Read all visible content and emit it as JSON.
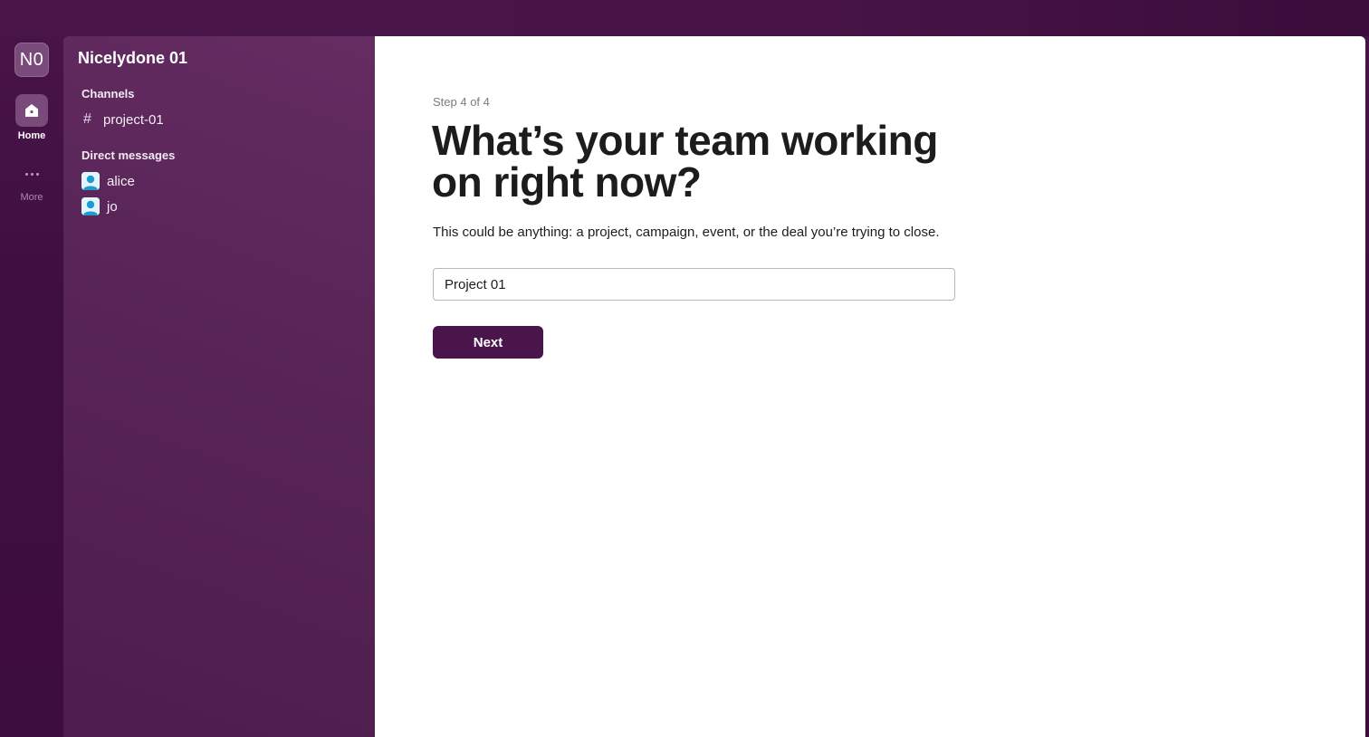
{
  "workspace": {
    "initials": "N0",
    "name": "Nicelydone 01"
  },
  "rail": {
    "home_label": "Home",
    "more_label": "More",
    "home_icon": "home-icon",
    "more_icon": "ellipsis-icon"
  },
  "sidebar": {
    "channels_title": "Channels",
    "channels": [
      {
        "label": "project-01",
        "icon": "hash-icon"
      }
    ],
    "dms_title": "Direct messages",
    "dms": [
      {
        "label": "alice",
        "icon": "user-avatar-icon"
      },
      {
        "label": "jo",
        "icon": "user-avatar-icon"
      }
    ]
  },
  "main": {
    "step_text": "Step 4 of 4",
    "heading": "What’s your team working on right now?",
    "description": "This could be anything: a project, campaign, event, or the deal you’re trying to close.",
    "input_value": "Project 01",
    "next_label": "Next"
  },
  "colors": {
    "aubergine": "#4a154b",
    "sidebar": "#5a2658",
    "rail_active": "#7a4b7a",
    "avatar_blue": "#1d9bd1"
  }
}
